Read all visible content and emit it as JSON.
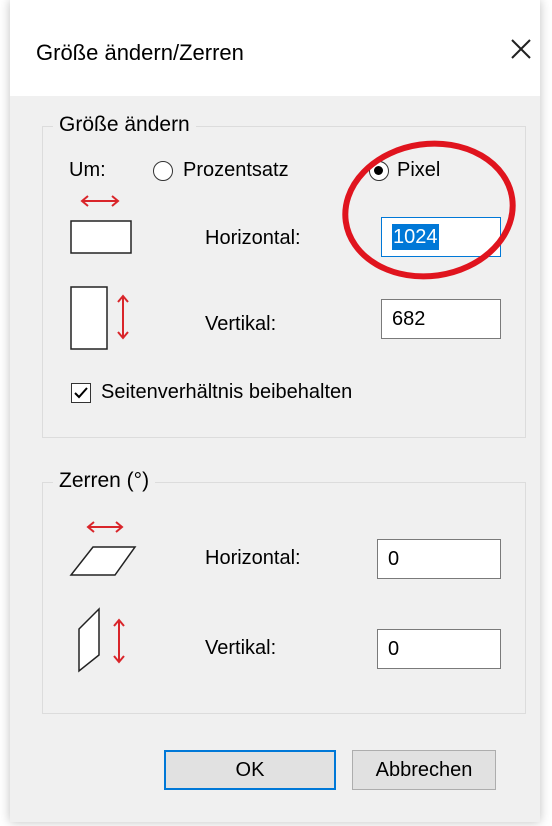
{
  "dialog": {
    "title": "Größe ändern/Zerren"
  },
  "resize": {
    "legend": "Größe ändern",
    "by_label": "Um:",
    "options": [
      {
        "label": "Prozentsatz",
        "selected": false
      },
      {
        "label": "Pixel",
        "selected": true
      }
    ],
    "horizontal_label": "Horizontal:",
    "horizontal_value": "1024",
    "vertical_label": "Vertikal:",
    "vertical_value": "682",
    "keep_aspect_label": "Seitenverhältnis beibehalten",
    "keep_aspect_checked": true
  },
  "skew": {
    "legend": "Zerren (°)",
    "horizontal_label": "Horizontal:",
    "horizontal_value": "0",
    "vertical_label": "Vertikal:",
    "vertical_value": "0"
  },
  "buttons": {
    "ok": "OK",
    "cancel": "Abbrechen"
  },
  "colors": {
    "accent": "#0078d7",
    "arrow": "#d9252a",
    "annotation": "#e0141e"
  }
}
